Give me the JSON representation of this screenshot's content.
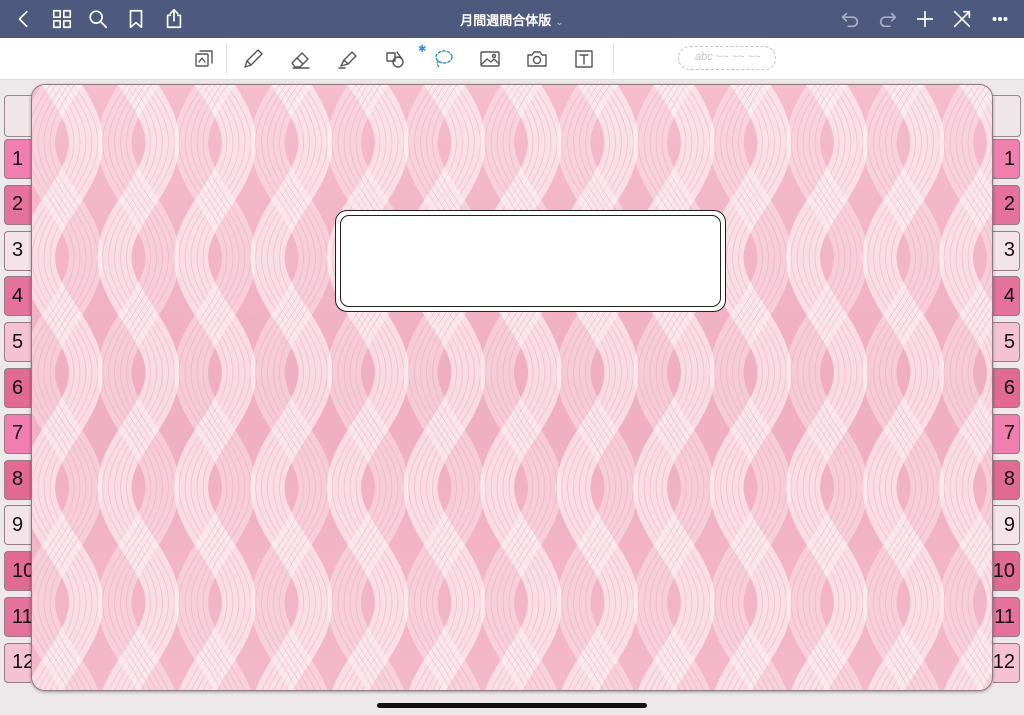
{
  "nav": {
    "title": "月間週間合体版",
    "title_chevron": "⌄"
  },
  "toolbar": {
    "handwriting_placeholder": "abc ~~ ~~ ~~",
    "active_tool": "lasso",
    "bluetooth_mark": "✱"
  },
  "side_tabs": {
    "labels": [
      "1",
      "2",
      "3",
      "4",
      "5",
      "6",
      "7",
      "8",
      "9",
      "10",
      "11",
      "12"
    ],
    "colors": [
      "#f07fb0",
      "#e4729a",
      "#f4e4ea",
      "#e4729a",
      "#f4c2d3",
      "#e06a92",
      "#f07fb0",
      "#e06a92",
      "#f4e4ea",
      "#e06a92",
      "#e4729a",
      "#f4c2d3"
    ]
  },
  "colors": {
    "nav_bg": "#4d5a7e",
    "page_pink": "#f2b3c6",
    "ribbon_white": "#ffffff",
    "active_tool_blue": "#2d8fe0"
  },
  "cover": {
    "label_text": ""
  }
}
